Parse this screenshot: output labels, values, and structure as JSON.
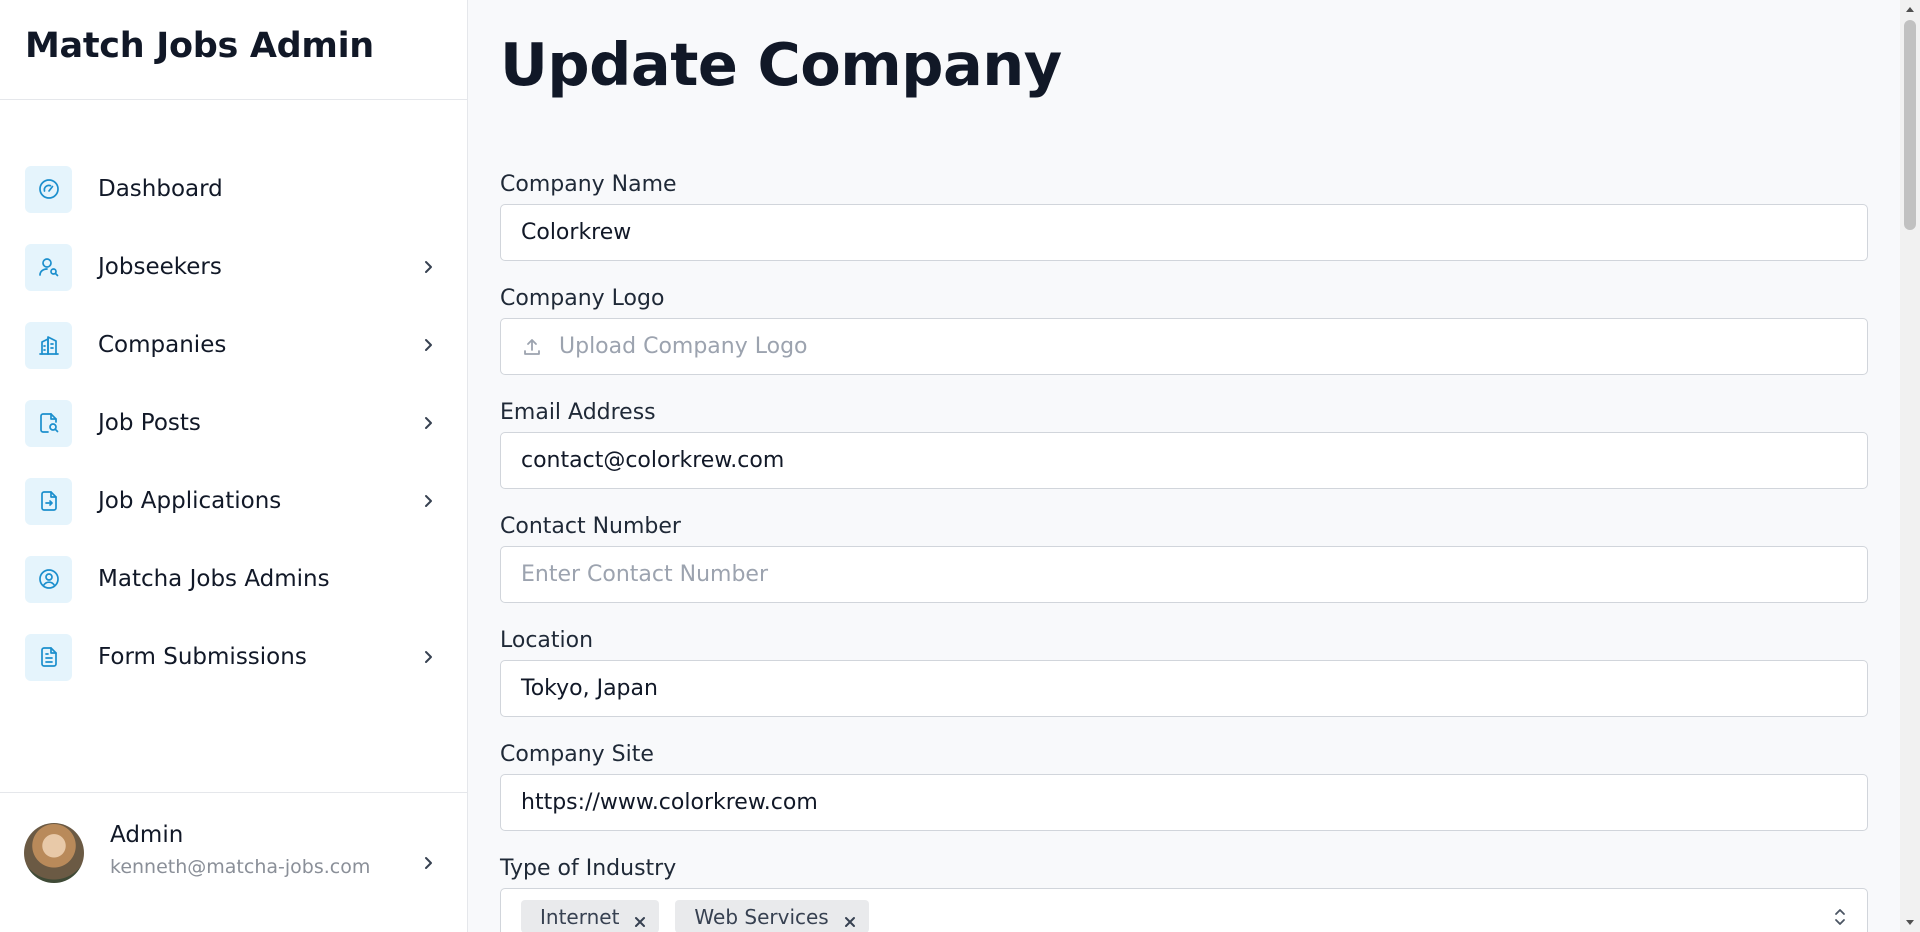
{
  "app": {
    "title": "Match Jobs Admin"
  },
  "sidebar": {
    "items": [
      {
        "label": "Dashboard",
        "icon": "gauge-icon",
        "has_submenu": false
      },
      {
        "label": "Jobseekers",
        "icon": "user-search-icon",
        "has_submenu": true
      },
      {
        "label": "Companies",
        "icon": "building-icon",
        "has_submenu": true
      },
      {
        "label": "Job Posts",
        "icon": "file-search-icon",
        "has_submenu": true
      },
      {
        "label": "Job Applications",
        "icon": "file-arrow-icon",
        "has_submenu": true
      },
      {
        "label": "Matcha Jobs Admins",
        "icon": "user-circle-icon",
        "has_submenu": false
      },
      {
        "label": "Form Submissions",
        "icon": "document-icon",
        "has_submenu": true
      }
    ],
    "user": {
      "name": "Admin",
      "email": "kenneth@matcha-jobs.com"
    }
  },
  "main": {
    "title": "Update Company",
    "fields": {
      "company_name": {
        "label": "Company Name",
        "value": "Colorkrew"
      },
      "company_logo": {
        "label": "Company Logo",
        "placeholder": "Upload Company Logo"
      },
      "email": {
        "label": "Email Address",
        "value": "contact@colorkrew.com"
      },
      "contact_number": {
        "label": "Contact Number",
        "placeholder": "Enter Contact Number"
      },
      "location": {
        "label": "Location",
        "value": "Tokyo, Japan"
      },
      "company_site": {
        "label": "Company Site",
        "value": "https://www.colorkrew.com"
      },
      "industry": {
        "label": "Type of Industry",
        "tags": [
          "Internet",
          "Web Services"
        ]
      }
    }
  },
  "colors": {
    "accent": "#1c8fcd",
    "icon_bg": "#e5f4fc",
    "border": "#d1d5db"
  }
}
